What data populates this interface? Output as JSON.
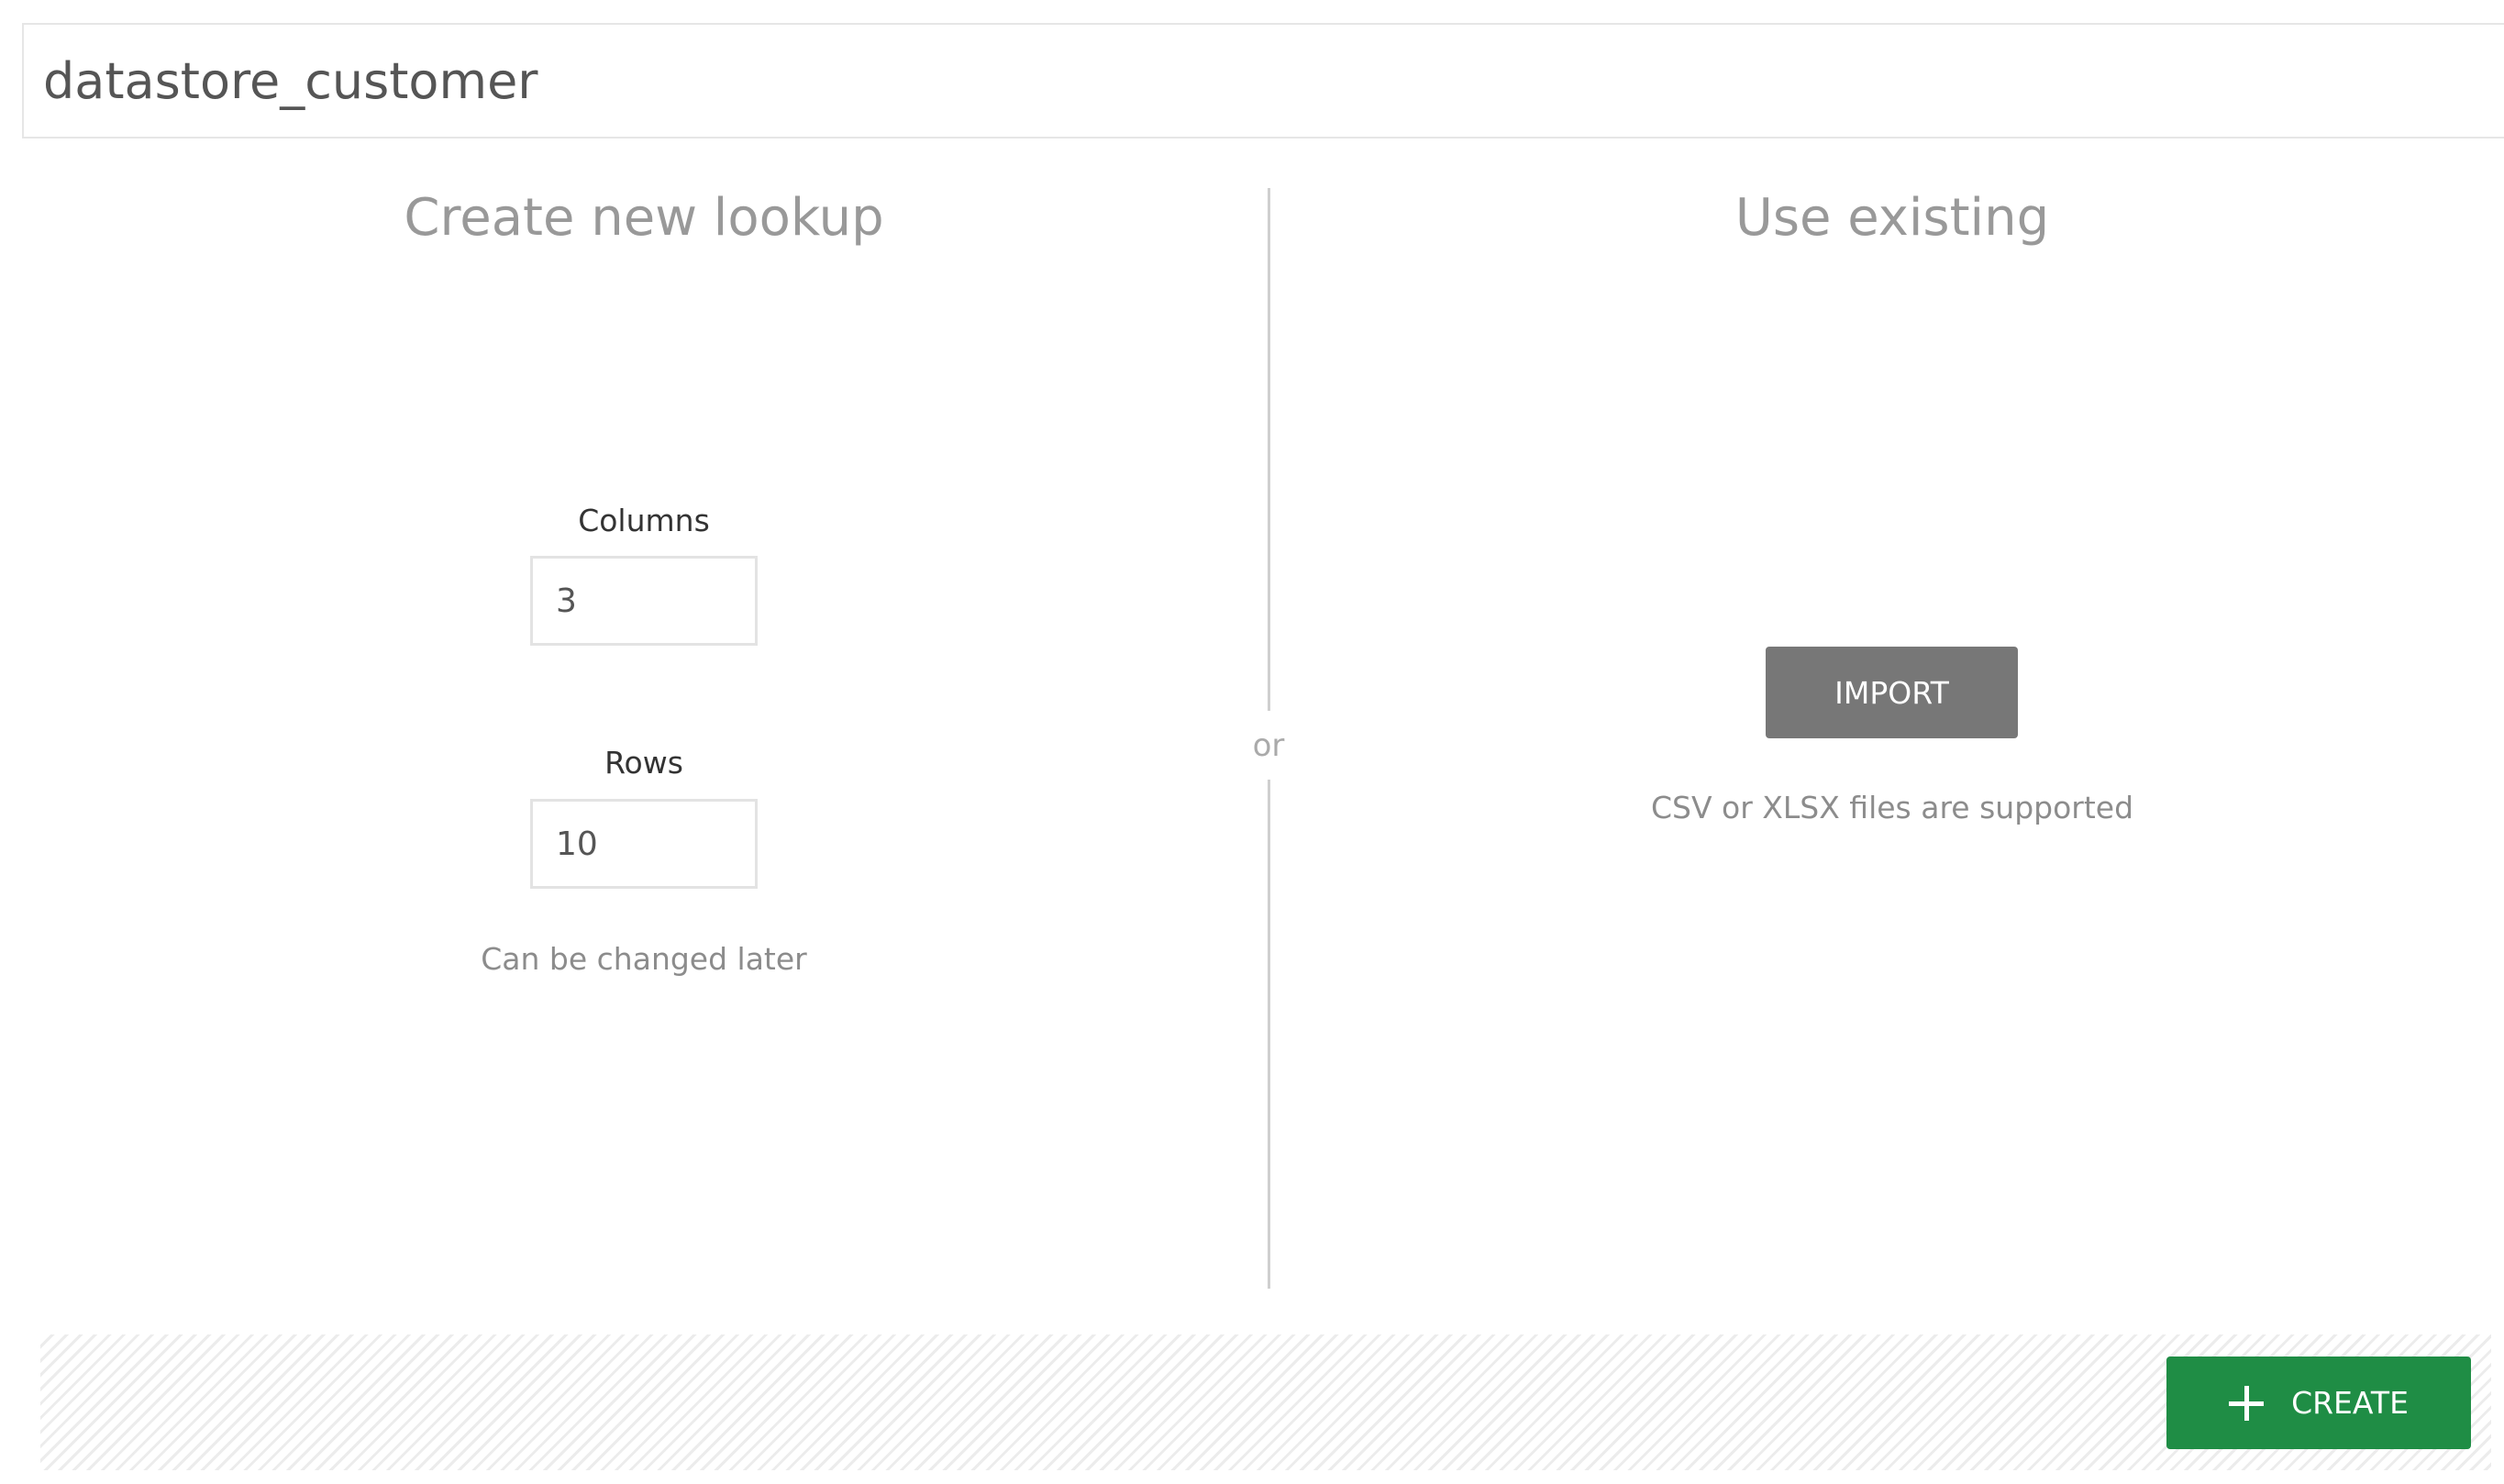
{
  "lookup": {
    "name_value": "datastore_customer"
  },
  "create_panel": {
    "title": "Create new lookup",
    "columns_label": "Columns",
    "columns_value": "3",
    "rows_label": "Rows",
    "rows_value": "10",
    "hint": "Can be changed later"
  },
  "divider": {
    "or_label": "or"
  },
  "existing_panel": {
    "title": "Use existing",
    "import_label": "IMPORT",
    "hint": "CSV or XLSX files are supported"
  },
  "footer": {
    "create_label": "CREATE",
    "create_icon": "plus-icon"
  }
}
